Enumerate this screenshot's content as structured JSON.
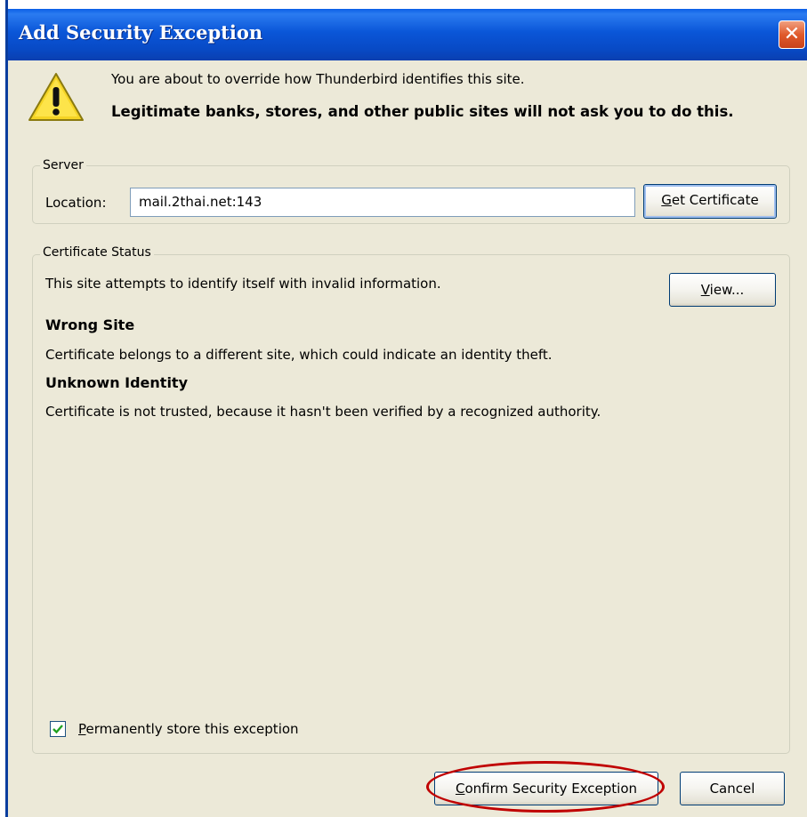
{
  "window": {
    "title": "Add Security Exception",
    "close_icon": "close-icon",
    "close_glyph": "✕"
  },
  "intro": {
    "icon": "warning-icon",
    "line1": "You are about to override how Thunderbird identifies this site.",
    "line2": "Legitimate banks, stores, and other public sites will not ask you to do this."
  },
  "server": {
    "legend": "Server",
    "location_label": "Location:",
    "location_value": "mail.2thai.net:143",
    "get_certificate_rest": "et Certificate",
    "get_certificate_accesskey": "G"
  },
  "certificate_status": {
    "legend": "Certificate Status",
    "summary": "This site attempts to identify itself with invalid information.",
    "view_accesskey": "V",
    "view_rest": "iew...",
    "wrong_site_heading": "Wrong Site",
    "wrong_site_text": "Certificate belongs to a different site, which could indicate an identity theft.",
    "unknown_identity_heading": "Unknown Identity",
    "unknown_identity_text": "Certificate is not trusted, because it hasn't been verified by a recognized authority."
  },
  "permanent": {
    "checked": true,
    "accesskey": "P",
    "rest": "ermanently store this exception"
  },
  "buttons": {
    "confirm_accesskey": "C",
    "confirm_rest": "onfirm Security Exception",
    "cancel": "Cancel"
  },
  "colors": {
    "titlebar": "#0a56d8",
    "dialog_bg": "#ece9d8",
    "highlight": "#c00000"
  }
}
